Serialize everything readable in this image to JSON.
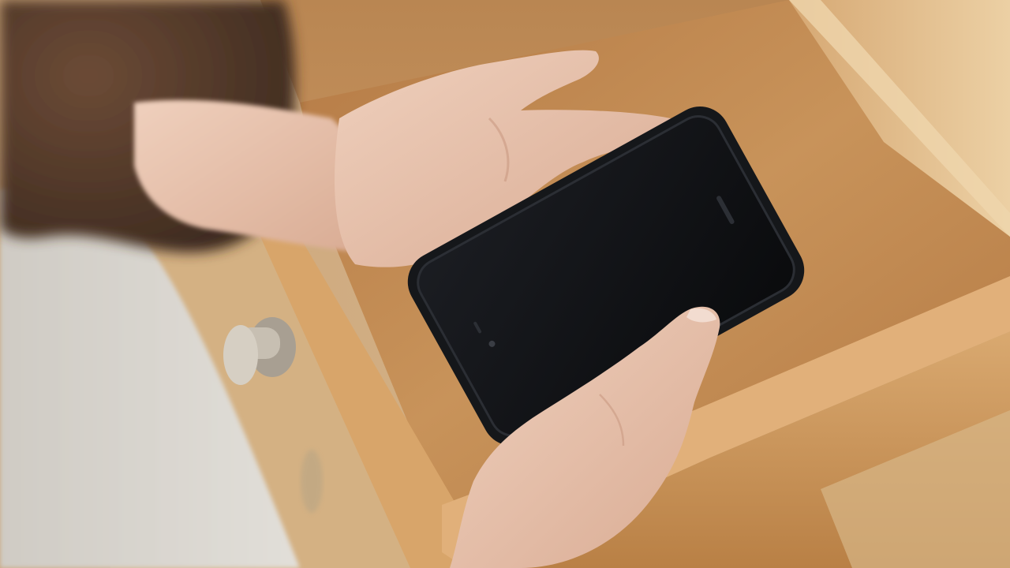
{
  "scene": {
    "description_visible_text": "",
    "colors": {
      "wood_light": "#e2bf8e",
      "wood_mid": "#c9955c",
      "wood_dark": "#a8743f",
      "drawer_floor": "#c08650",
      "skin": "#e9c6b2",
      "skin_shadow": "#d2a48c",
      "phone_body": "#141619",
      "phone_screen": "#0c0d10",
      "sweater": "#d9d6d0",
      "hair": "#5a3f2e",
      "knob": "#c7bfb2"
    },
    "icons": [
      "drawer-knob-icon",
      "phone-camera-icon",
      "phone-speaker-icon"
    ]
  }
}
